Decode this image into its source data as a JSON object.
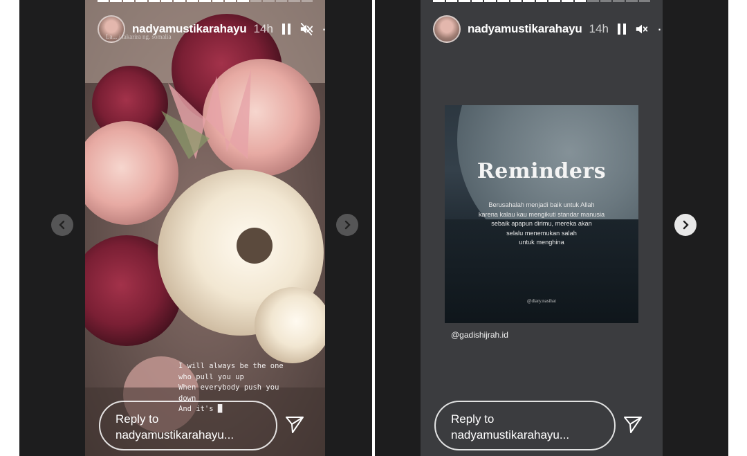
{
  "left_story": {
    "username": "nadyamustikarahayu",
    "time": "14h",
    "subline": "La...   / takarira ng. somalia",
    "caption_lines": [
      "I will always be the one",
      "who pull you up",
      "When everybody push you",
      "down",
      "And it's █"
    ],
    "reply_line1": "Reply to",
    "reply_line2": "nadyamustikarahayu...",
    "icons": {
      "pause": "pause-icon",
      "sound": "sound-muted-icon",
      "more": "more-icon",
      "send": "send-icon"
    }
  },
  "right_story": {
    "username": "nadyamustikarahayu",
    "time": "14h",
    "poster_title": "Reminders",
    "poster_body": [
      "Berusahalah menjadi baik untuk Allah",
      "karena kalau kau mengikuti standar manusia",
      "sebaik apapun dirimu, mereka akan",
      "selalu menemukan salah",
      "untuk menghina"
    ],
    "poster_footer": "@diary.nasihat",
    "mention": "@gadishijrah.id",
    "reply_line1": "Reply to",
    "reply_line2": "nadyamustikarahayu...",
    "icons": {
      "pause": "pause-icon",
      "sound": "sound-muted-icon",
      "more": "more-icon",
      "send": "send-icon"
    }
  },
  "more_glyph": "···",
  "colors": {
    "backdrop": "#1d1d1e",
    "text": "#ffffff"
  }
}
